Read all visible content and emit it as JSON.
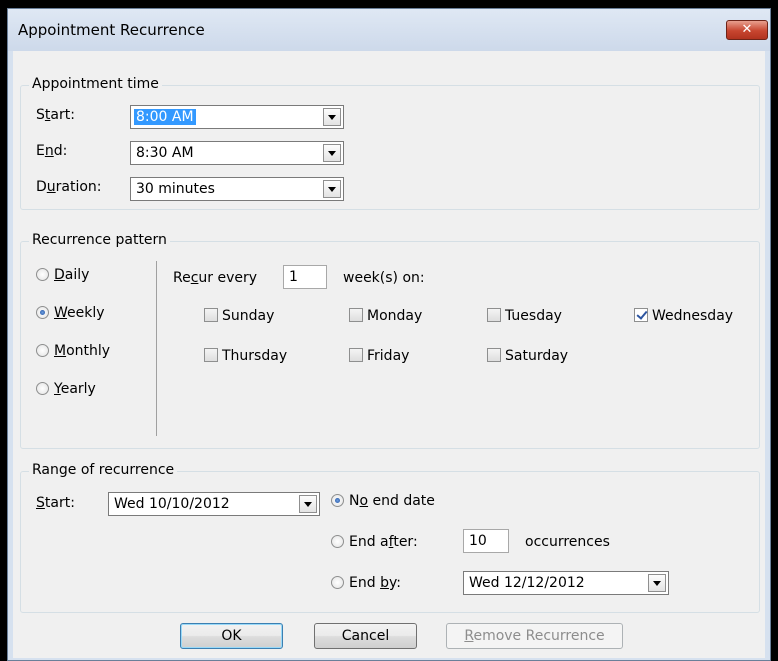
{
  "window": {
    "title": "Appointment Recurrence",
    "close_label": "✕"
  },
  "appointment_time": {
    "group_label": "Appointment time",
    "start": {
      "label_pre": "S",
      "label_key": "t",
      "label_post": "art:",
      "value": "8:00 AM"
    },
    "end": {
      "label_pre": "E",
      "label_key": "n",
      "label_post": "d:",
      "value": "8:30 AM"
    },
    "duration": {
      "label_pre": "D",
      "label_key": "u",
      "label_post": "ration:",
      "value": "30 minutes"
    }
  },
  "recurrence_pattern": {
    "group_label": "Recurrence pattern",
    "frequencies": [
      {
        "pre": "",
        "key": "D",
        "post": "aily",
        "selected": false
      },
      {
        "pre": "",
        "key": "W",
        "post": "eekly",
        "selected": true
      },
      {
        "pre": "",
        "key": "M",
        "post": "onthly",
        "selected": false
      },
      {
        "pre": "",
        "key": "Y",
        "post": "early",
        "selected": false
      }
    ],
    "recur_every": {
      "label_pre": "Re",
      "label_key": "c",
      "label_post": "ur every",
      "value": "1",
      "suffix": "week(s) on:"
    },
    "days": [
      {
        "label": "Sunday",
        "checked": false
      },
      {
        "label": "Monday",
        "checked": false
      },
      {
        "label": "Tuesday",
        "checked": false
      },
      {
        "label": "Wednesday",
        "checked": true
      },
      {
        "label": "Thursday",
        "checked": false
      },
      {
        "label": "Friday",
        "checked": false
      },
      {
        "label": "Saturday",
        "checked": false
      }
    ]
  },
  "range": {
    "group_label": "Range of recurrence",
    "start": {
      "label_pre": "",
      "label_key": "S",
      "label_post": "tart:",
      "value": "Wed 10/10/2012"
    },
    "no_end": {
      "pre": "N",
      "key": "o",
      "post": " end date",
      "selected": true
    },
    "end_after": {
      "pre": "End a",
      "key": "f",
      "post": "ter:",
      "selected": false,
      "value": "10",
      "suffix": "occurrences"
    },
    "end_by": {
      "pre": "End ",
      "key": "b",
      "post": "y:",
      "selected": false,
      "value": "Wed 12/12/2012"
    }
  },
  "buttons": {
    "ok": "OK",
    "cancel": "Cancel",
    "remove": {
      "pre": "",
      "key": "R",
      "post": "emove Recurrence"
    }
  }
}
